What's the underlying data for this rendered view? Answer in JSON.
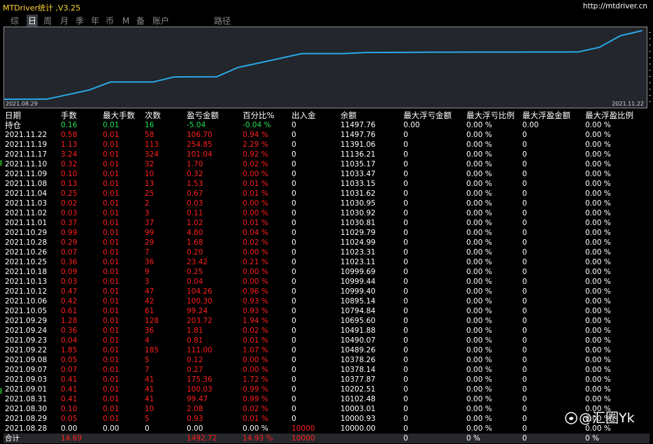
{
  "window": {
    "title": "MTDriver统计 ,V3.25",
    "site": "http://mtdriver.cn"
  },
  "tabs": [
    {
      "label": "综"
    },
    {
      "label": "日",
      "active": true
    },
    {
      "label": "周"
    },
    {
      "label": "月"
    },
    {
      "label": "季"
    },
    {
      "label": "年"
    },
    {
      "label": "币"
    },
    {
      "label": "M"
    },
    {
      "label": "备"
    },
    {
      "label": "账户"
    },
    {
      "label": "路径"
    }
  ],
  "chart": {
    "start_label": "2021.08.29",
    "end_label": "2021.11.22",
    "line_color": "#29a8e6"
  },
  "chart_data": {
    "type": "line",
    "x": [
      "2021.08.28",
      "2021.08.29",
      "2021.08.30",
      "2021.08.31",
      "2021.09.01",
      "2021.09.03",
      "2021.09.07",
      "2021.09.08",
      "2021.09.22",
      "2021.09.23",
      "2021.09.24",
      "2021.09.29",
      "2021.10.05",
      "2021.10.06",
      "2021.10.12",
      "2021.10.13",
      "2021.10.18",
      "2021.10.25",
      "2021.10.26",
      "2021.10.28",
      "2021.10.29",
      "2021.11.01",
      "2021.11.02",
      "2021.11.03",
      "2021.11.04",
      "2021.11.08",
      "2021.11.09",
      "2021.11.10",
      "2021.11.17",
      "2021.11.19",
      "2021.11.22"
    ],
    "series": [
      {
        "values": [
          10000.0,
          10000.93,
          10003.01,
          10102.48,
          10202.51,
          10377.87,
          10378.14,
          10378.26,
          10489.26,
          10490.07,
          10491.88,
          10695.6,
          10794.84,
          10895.14,
          10999.4,
          10999.44,
          10999.69,
          11023.11,
          11023.31,
          11024.99,
          11029.79,
          11030.81,
          11030.92,
          11030.95,
          11031.62,
          11033.15,
          11033.47,
          11035.17,
          11136.21,
          11391.06,
          11497.76
        ]
      }
    ],
    "xlabel": "",
    "ylabel": "",
    "grid": false
  },
  "table": {
    "headers": [
      "日期",
      "手数",
      "最大手数",
      "次数",
      "盈亏金额",
      "百分比%",
      "出入金",
      "余额",
      "最大浮亏金额",
      "最大浮亏比例",
      "最大浮盈金额",
      "最大浮盈比例"
    ],
    "holding": [
      "持仓",
      "0.16",
      "0.01",
      "16",
      "-5.04",
      "-0.04 %",
      "0",
      "11497.76",
      "0.00",
      "0.00 %",
      "0.00",
      "0.00 %"
    ],
    "rows": [
      [
        "2021.11.22",
        "0.58",
        "0.01",
        "58",
        "106.70",
        "0.94 %",
        "0",
        "11497.76",
        "0",
        "0.00 %",
        "0",
        "0.00 %"
      ],
      [
        "2021.11.19",
        "1.13",
        "0.01",
        "113",
        "254.85",
        "2.29 %",
        "0",
        "11391.06",
        "0",
        "0.00 %",
        "0",
        "0.00 %"
      ],
      [
        "2021.11.17",
        "3.24",
        "0.01",
        "324",
        "101.04",
        "0.92 %",
        "0",
        "11136.21",
        "0",
        "0.00 %",
        "0",
        "0.00 %"
      ],
      [
        "2021.11.10",
        "0.32",
        "0.01",
        "32",
        "1.70",
        "0.02 %",
        "0",
        "11035.17",
        "0",
        "0.00 %",
        "0",
        "0.00 %"
      ],
      [
        "2021.11.09",
        "0.10",
        "0.01",
        "10",
        "0.32",
        "0.00 %",
        "0",
        "11033.47",
        "0",
        "0.00 %",
        "0",
        "0.00 %"
      ],
      [
        "2021.11.08",
        "0.13",
        "0.01",
        "13",
        "1.53",
        "0.01 %",
        "0",
        "11033.15",
        "0",
        "0.00 %",
        "0",
        "0.00 %"
      ],
      [
        "2021.11.04",
        "0.25",
        "0.01",
        "25",
        "0.67",
        "0.01 %",
        "0",
        "11031.62",
        "0",
        "0.00 %",
        "0",
        "0.00 %"
      ],
      [
        "2021.11.03",
        "0.02",
        "0.01",
        "2",
        "0.03",
        "0.00 %",
        "0",
        "11030.95",
        "0",
        "0.00 %",
        "0",
        "0.00 %"
      ],
      [
        "2021.11.02",
        "0.03",
        "0.01",
        "3",
        "0.11",
        "0.00 %",
        "0",
        "11030.92",
        "0",
        "0.00 %",
        "0",
        "0.00 %"
      ],
      [
        "2021.11.01",
        "0.37",
        "0.01",
        "37",
        "1.02",
        "0.01 %",
        "0",
        "11030.81",
        "0",
        "0.00 %",
        "0",
        "0.00 %"
      ],
      [
        "2021.10.29",
        "0.99",
        "0.01",
        "99",
        "4.80",
        "0.04 %",
        "0",
        "11029.79",
        "0",
        "0.00 %",
        "0",
        "0.00 %"
      ],
      [
        "2021.10.28",
        "0.29",
        "0.01",
        "29",
        "1.68",
        "0.02 %",
        "0",
        "11024.99",
        "0",
        "0.00 %",
        "0",
        "0.00 %"
      ],
      [
        "2021.10.26",
        "0.07",
        "0.01",
        "7",
        "0.20",
        "0.00 %",
        "0",
        "11023.31",
        "0",
        "0.00 %",
        "0",
        "0.00 %"
      ],
      [
        "2021.10.25",
        "0.36",
        "0.01",
        "36",
        "23.42",
        "0.21 %",
        "0",
        "11023.11",
        "0",
        "0.00 %",
        "0",
        "0.00 %"
      ],
      [
        "2021.10.18",
        "0.09",
        "0.01",
        "9",
        "0.25",
        "0.00 %",
        "0",
        "10999.69",
        "0",
        "0.00 %",
        "0",
        "0.00 %"
      ],
      [
        "2021.10.13",
        "0.03",
        "0.01",
        "3",
        "0.04",
        "0.00 %",
        "0",
        "10999.44",
        "0",
        "0.00 %",
        "0",
        "0.00 %"
      ],
      [
        "2021.10.12",
        "0.47",
        "0.01",
        "47",
        "104.26",
        "0.96 %",
        "0",
        "10999.40",
        "0",
        "0.00 %",
        "0",
        "0.00 %"
      ],
      [
        "2021.10.06",
        "0.42",
        "0.01",
        "42",
        "100.30",
        "0.93 %",
        "0",
        "10895.14",
        "0",
        "0.00 %",
        "0",
        "0.00 %"
      ],
      [
        "2021.10.05",
        "0.61",
        "0.01",
        "61",
        "99.24",
        "0.93 %",
        "0",
        "10794.84",
        "0",
        "0.00 %",
        "0",
        "0.00 %"
      ],
      [
        "2021.09.29",
        "1.28",
        "0.01",
        "128",
        "203.72",
        "1.94 %",
        "0",
        "10695.60",
        "0",
        "0.00 %",
        "0",
        "0.00 %"
      ],
      [
        "2021.09.24",
        "0.36",
        "0.01",
        "36",
        "1.81",
        "0.02 %",
        "0",
        "10491.88",
        "0",
        "0.00 %",
        "0",
        "0.00 %"
      ],
      [
        "2021.09.23",
        "0.04",
        "0.01",
        "4",
        "0.81",
        "0.01 %",
        "0",
        "10490.07",
        "0",
        "0.00 %",
        "0",
        "0.00 %"
      ],
      [
        "2021.09.22",
        "1.85",
        "0.01",
        "185",
        "111.00",
        "1.07 %",
        "0",
        "10489.26",
        "0",
        "0.00 %",
        "0",
        "0.00 %"
      ],
      [
        "2021.09.08",
        "0.05",
        "0.01",
        "5",
        "0.12",
        "0.00 %",
        "0",
        "10378.26",
        "0",
        "0.00 %",
        "0",
        "0.00 %"
      ],
      [
        "2021.09.07",
        "0.07",
        "0.01",
        "7",
        "0.27",
        "0.00 %",
        "0",
        "10378.14",
        "0",
        "0.00 %",
        "0",
        "0.00 %"
      ],
      [
        "2021.09.03",
        "0.41",
        "0.01",
        "41",
        "175.36",
        "1.72 %",
        "0",
        "10377.87",
        "0",
        "0.00 %",
        "0",
        "0.00 %"
      ],
      [
        "2021.09.01",
        "0.41",
        "0.01",
        "41",
        "100.03",
        "0.99 %",
        "0",
        "10202.51",
        "0",
        "0.00 %",
        "0",
        "0.00 %"
      ],
      [
        "2021.08.31",
        "0.41",
        "0.01",
        "41",
        "99.47",
        "0.99 %",
        "0",
        "10102.48",
        "0",
        "0.00 %",
        "0",
        "0.00 %"
      ],
      [
        "2021.08.30",
        "0.10",
        "0.01",
        "10",
        "2.08",
        "0.02 %",
        "0",
        "10003.01",
        "0",
        "0.00 %",
        "0",
        "0.00 %"
      ],
      [
        "2021.08.29",
        "0.05",
        "0.01",
        "5",
        "0.93",
        "0.01 %",
        "0",
        "10000.93",
        "0",
        "0.00 %",
        "0",
        "0.00 %"
      ]
    ],
    "deposit_row": [
      "2021.08.28",
      "0.00",
      "0.00",
      "0",
      "0.00",
      "0.00 %",
      "10000",
      "10000.00",
      "0",
      "0.00 %",
      "0",
      "0.00 %"
    ],
    "total_row": [
      "合计",
      "14.69",
      "",
      "",
      "1492.72",
      "14.93 %",
      "10000",
      "",
      "0",
      "0 %",
      "0",
      "0 %"
    ]
  },
  "watermark": {
    "text": "@汇圈Yk",
    "icon": "weibo-icon"
  },
  "colors": {
    "title": "#ffd43a",
    "negative": "#ff1f1f",
    "positive": "#27e05a",
    "line": "#29a8e6",
    "chart_bg": "#23262c"
  }
}
